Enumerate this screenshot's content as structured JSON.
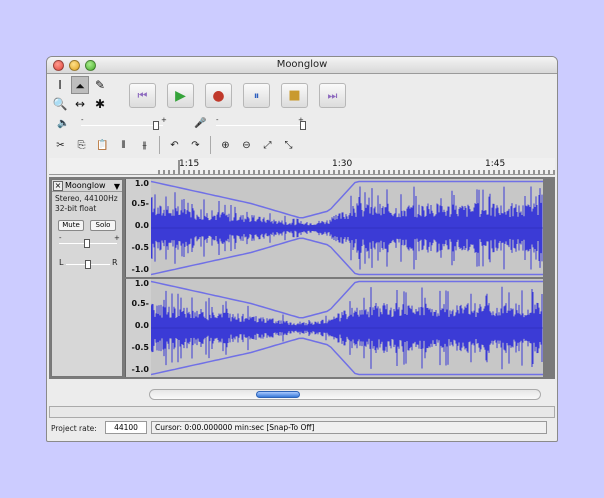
{
  "window": {
    "title": "Moonglow"
  },
  "toolbox": {
    "tools": [
      {
        "glyph": "I"
      },
      {
        "glyph": "⏶"
      },
      {
        "glyph": "✎"
      },
      {
        "glyph": "🔍"
      },
      {
        "glyph": "↔"
      },
      {
        "glyph": "✱"
      }
    ]
  },
  "transport": {
    "buttons": [
      {
        "glyph": "⏮",
        "color": "#8e6bbf"
      },
      {
        "glyph": "▶",
        "color": "#35a33a"
      },
      {
        "glyph": "●",
        "color": "#c0392b"
      },
      {
        "glyph": "⏸",
        "color": "#2d5fbf"
      },
      {
        "glyph": "■",
        "color": "#c99a2e"
      },
      {
        "glyph": "⏭",
        "color": "#8e6bbf"
      }
    ]
  },
  "mixer": {
    "output_minus": "-",
    "output_plus": "+",
    "input_minus": "-",
    "input_plus": "+",
    "output_level": 0.9,
    "input_level": 0.85
  },
  "editbar": {
    "buttons": [
      {
        "glyph": "✂"
      },
      {
        "glyph": "⎘"
      },
      {
        "glyph": "📋"
      },
      {
        "glyph": "⫴"
      },
      {
        "glyph": "⫵"
      },
      {
        "glyph": "↶"
      },
      {
        "glyph": "↷"
      },
      {
        "glyph": "⊕"
      },
      {
        "glyph": "⊖"
      },
      {
        "glyph": "⤢"
      },
      {
        "glyph": "⤡"
      }
    ]
  },
  "ruler": {
    "labels": [
      "1:15",
      "1:30",
      "1:45"
    ]
  },
  "track": {
    "name": "Moonglow",
    "format": "Stereo, 44100Hz",
    "bits": "32-bit float",
    "mute": "Mute",
    "solo": "Solo",
    "gain_minus": "-",
    "gain_plus": "+",
    "pan_left": "L",
    "pan_right": "R",
    "close": "×",
    "menu_arrow": "▼",
    "scale": [
      "1.0",
      "0.5-",
      "0.0",
      "-0.5",
      "-1.0"
    ]
  },
  "colors": {
    "wave": "#3b3bd6",
    "wave_bg": "#c7c7c7",
    "envelope": "#7070e6"
  },
  "footer": {
    "project_rate_label": "Project rate:",
    "project_rate": "44100",
    "cursor": "Cursor: 0:00.000000 min:sec  [Snap-To Off]"
  }
}
